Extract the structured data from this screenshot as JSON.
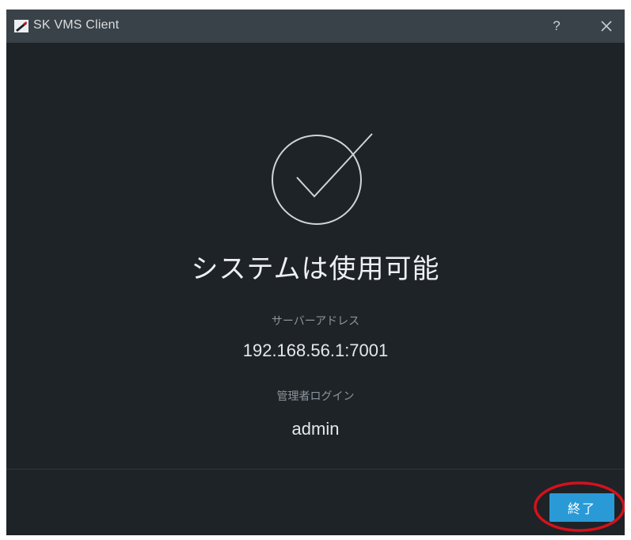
{
  "window": {
    "title": "SK VMS Client",
    "help_label": "?"
  },
  "main": {
    "headline": "システムは使用可能",
    "server_address_label": "サーバーアドレス",
    "server_address_value": "192.168.56.1:7001",
    "admin_login_label": "管理者ログイン",
    "admin_login_value": "admin"
  },
  "footer": {
    "finish_label": "終了"
  },
  "icons": {
    "app": "app-logo-icon",
    "help": "help-icon",
    "close": "close-icon",
    "status": "checkmark-circle-icon"
  },
  "colors": {
    "titlebar": "#3a4249",
    "background": "#1e2327",
    "accent_button": "#2a9ad7",
    "highlight_ring": "#d3121a"
  }
}
